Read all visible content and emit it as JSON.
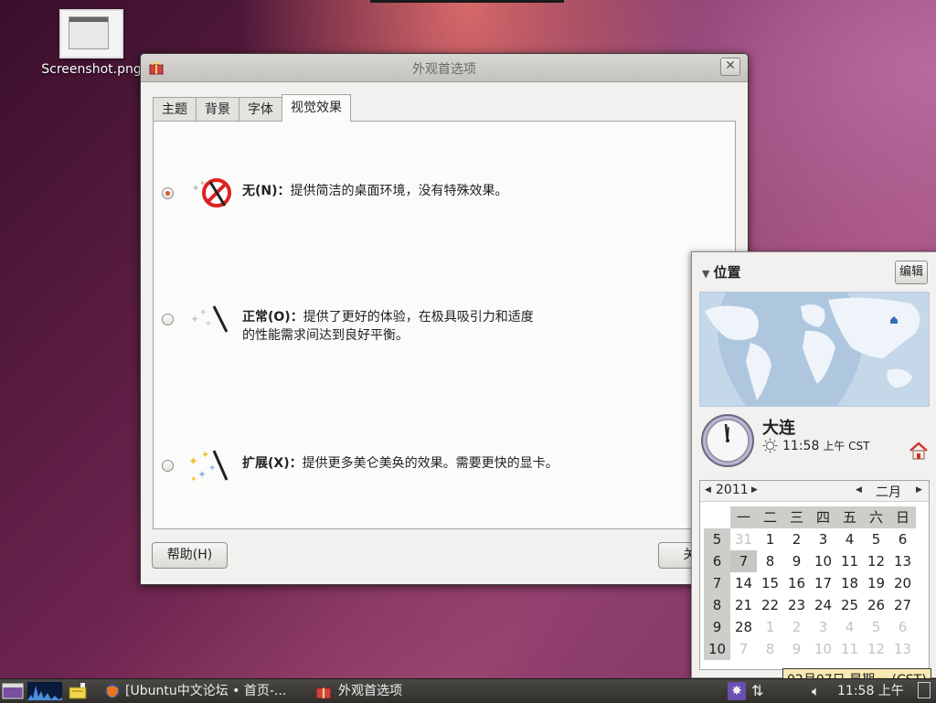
{
  "desktop": {
    "icon_label": "Screenshot.png"
  },
  "window": {
    "title": "外观首选项",
    "close_glyph": "✕",
    "tabs": [
      {
        "label": "主题"
      },
      {
        "label": "背景"
      },
      {
        "label": "字体"
      },
      {
        "label": "视觉效果"
      }
    ],
    "options": [
      {
        "key": "无(N)：",
        "desc": "提供简洁的桌面环境，没有特殊效果。",
        "desc2": "",
        "checked": true
      },
      {
        "key": "正常(O)：",
        "desc": "提供了更好的体验，在极具吸引力和适度",
        "desc2": "的性能需求间达到良好平衡。",
        "checked": false
      },
      {
        "key": "扩展(X)：",
        "desc": "提供更多美仑美奂的效果。需要更快的显卡。",
        "desc2": "",
        "checked": false
      }
    ],
    "help_label": "帮助(H)",
    "close_label": "关闭"
  },
  "clock_popup": {
    "section_title": "位置",
    "edit_label": "编辑",
    "city": "大连",
    "time": "11:58",
    "ampm": "上午 CST",
    "calendar": {
      "year": "2011",
      "month": "二月",
      "weekdays": [
        "一",
        "二",
        "三",
        "四",
        "五",
        "六",
        "日"
      ],
      "weeks": [
        {
          "wk": "5",
          "days": [
            "31",
            "1",
            "2",
            "3",
            "4",
            "5",
            "6"
          ]
        },
        {
          "wk": "6",
          "days": [
            "7",
            "8",
            "9",
            "10",
            "11",
            "12",
            "13"
          ]
        },
        {
          "wk": "7",
          "days": [
            "14",
            "15",
            "16",
            "17",
            "18",
            "19",
            "20"
          ]
        },
        {
          "wk": "8",
          "days": [
            "21",
            "22",
            "23",
            "24",
            "25",
            "26",
            "27"
          ]
        },
        {
          "wk": "9",
          "days": [
            "28",
            "1",
            "2",
            "3",
            "4",
            "5",
            "6"
          ]
        },
        {
          "wk": "10",
          "days": [
            "7",
            "8",
            "9",
            "10",
            "11",
            "12",
            "13"
          ]
        }
      ]
    }
  },
  "taskbar": {
    "browser_task": "[Ubuntu中文论坛 • 首页-...",
    "prefs_task": "外观首选项",
    "clock_partial": "11:58 上午"
  },
  "tooltip": "02月07日 星期一 (CST)",
  "colors": {
    "radio_dot": "#d7562b",
    "taskbar": "#3c3b37",
    "map_land": "#eef4fa",
    "map_sea": "#c5d8ea"
  }
}
